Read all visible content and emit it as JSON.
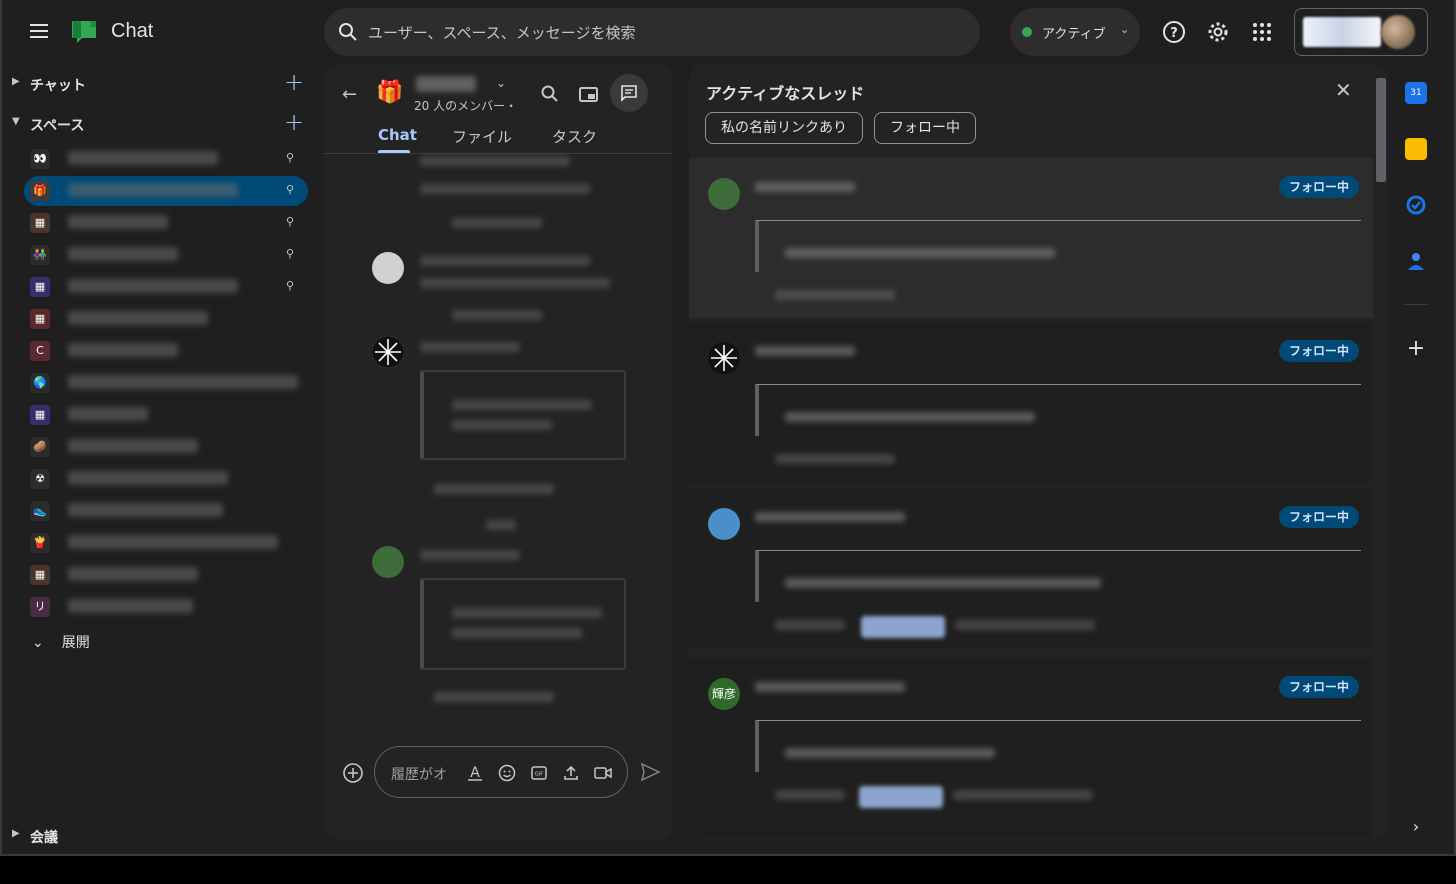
{
  "app": {
    "title": "Chat",
    "search_placeholder": "ユーザー、スペース、メッセージを検索",
    "status_label": "アクティブ"
  },
  "sidebar": {
    "chat_section": "チャット",
    "spaces_section": "スペース",
    "expand_label": "展開",
    "meetings_section": "会議",
    "spaces": [
      {
        "icon": "eyes-emoji",
        "color": "#2b2b2b",
        "glyph": "👀",
        "pinned": true,
        "active": false
      },
      {
        "icon": "gift-emoji",
        "color": "#3c3c3c",
        "glyph": "🎁",
        "pinned": true,
        "active": true
      },
      {
        "icon": "grid-icon",
        "color": "#4a3526",
        "glyph": "▦",
        "pinned": true,
        "active": false
      },
      {
        "icon": "people-emoji",
        "color": "#2b2b2b",
        "glyph": "👫",
        "pinned": true,
        "active": false
      },
      {
        "icon": "grid-icon",
        "color": "#35306a",
        "glyph": "▦",
        "pinned": true,
        "active": false
      },
      {
        "icon": "grid-icon",
        "color": "#5a2a2a",
        "glyph": "▦",
        "pinned": false,
        "active": false
      },
      {
        "icon": "letter-c",
        "color": "#5a2a34",
        "glyph": "C",
        "pinned": false,
        "active": false
      },
      {
        "icon": "globe-emoji",
        "color": "#2b2b2b",
        "glyph": "🌎",
        "pinned": false,
        "active": false
      },
      {
        "icon": "grid-icon",
        "color": "#35306a",
        "glyph": "▦",
        "pinned": false,
        "active": false
      },
      {
        "icon": "potato-emoji",
        "color": "#2b2b2b",
        "glyph": "🥔",
        "pinned": false,
        "active": false
      },
      {
        "icon": "radioactive-emoji",
        "color": "#2b2b2b",
        "glyph": "☢",
        "pinned": false,
        "active": false
      },
      {
        "icon": "shoe-emoji",
        "color": "#2b2b2b",
        "glyph": "👟",
        "pinned": false,
        "active": false
      },
      {
        "icon": "fries-emoji",
        "color": "#2b2b2b",
        "glyph": "🍟",
        "pinned": false,
        "active": false
      },
      {
        "icon": "grid-icon",
        "color": "#4a3526",
        "glyph": "▦",
        "pinned": false,
        "active": false
      },
      {
        "icon": "letter-ri",
        "color": "#4a2a44",
        "glyph": "リ",
        "pinned": false,
        "active": false
      }
    ]
  },
  "chat": {
    "members": "20 人のメンバー・",
    "tabs": [
      "Chat",
      "ファイル",
      "タスク"
    ],
    "composer_placeholder": "履歴がオ"
  },
  "threads": {
    "title": "アクティブなスレッド",
    "filters": [
      "私の名前リンクあり",
      "フォロー中"
    ],
    "follow_label": "フォロー中",
    "avatar_text_4": "輝彦"
  }
}
